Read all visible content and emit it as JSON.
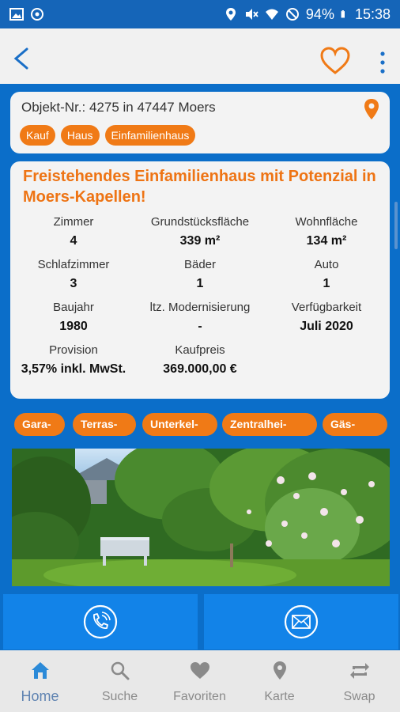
{
  "status_bar": {
    "battery": "94%",
    "time": "15:38",
    "icons": [
      "image-icon",
      "sync-icon",
      "location-icon",
      "mute-icon",
      "wifi-icon",
      "dnd-icon",
      "battery-icon"
    ]
  },
  "app_bar": {
    "back_icon": "chevron-left-icon",
    "favorite_icon": "heart-outline-icon",
    "more_icon": "more-vert-icon"
  },
  "object": {
    "title": "Objekt-Nr.: 4275 in 47447 Moers",
    "tags": [
      "Kauf",
      "Haus",
      "Einfamilienhaus"
    ]
  },
  "details": {
    "headline": "Freistehendes Einfamilienhaus mit Potenzial in Moers-Kapellen!",
    "facts": [
      {
        "label": "Zimmer",
        "value": "4"
      },
      {
        "label": "Grundstücksfläche",
        "value": "339 m²"
      },
      {
        "label": "Wohnfläche",
        "value": "134 m²"
      },
      {
        "label": "Schlafzimmer",
        "value": "3"
      },
      {
        "label": "Bäder",
        "value": "1"
      },
      {
        "label": "Auto",
        "value": "1"
      },
      {
        "label": "Baujahr",
        "value": "1980"
      },
      {
        "label": "ltz. Modernisierung",
        "value": "-"
      },
      {
        "label": "Verfügbarkeit",
        "value": "Juli 2020"
      },
      {
        "label": "Provision",
        "value": "3,57% inkl. MwSt."
      },
      {
        "label": "Kaufpreis",
        "value": "369.000,00 €"
      }
    ]
  },
  "features": [
    "Gara-",
    "Terras-",
    "Unterkel-",
    "Zentralhei-",
    "Gäs-"
  ],
  "contact": {
    "call_icon": "phone-icon",
    "mail_icon": "mail-icon"
  },
  "bottom_nav": [
    {
      "label": "Home",
      "icon": "home-icon",
      "active": true
    },
    {
      "label": "Suche",
      "icon": "search-icon",
      "active": false
    },
    {
      "label": "Favoriten",
      "icon": "heart-icon",
      "active": false
    },
    {
      "label": "Karte",
      "icon": "map-pin-icon",
      "active": false
    },
    {
      "label": "Swap",
      "icon": "swap-icon",
      "active": false
    }
  ],
  "colors": {
    "primary_blue": "#0b6ec9",
    "accent_orange": "#f07a16",
    "button_blue": "#1283e8"
  }
}
